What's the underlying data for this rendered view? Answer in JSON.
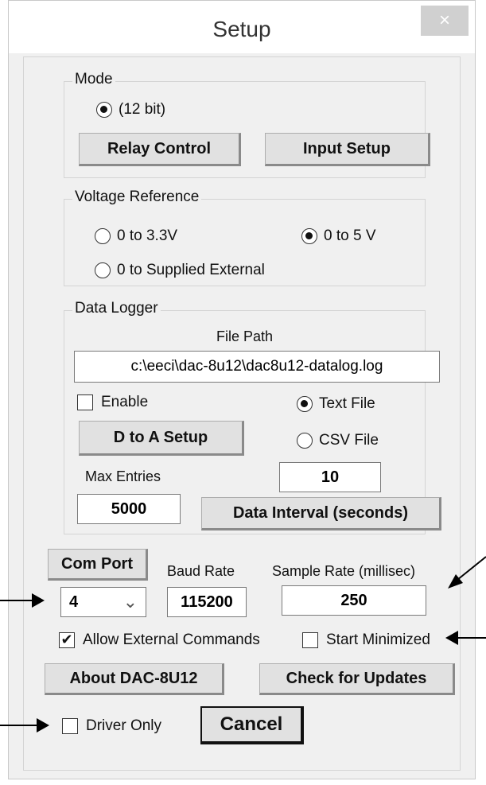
{
  "window": {
    "title": "Setup",
    "close_glyph": "×"
  },
  "mode": {
    "legend": "Mode",
    "radio_label": "(12 bit)",
    "relay_button": "Relay Control",
    "input_button": "Input Setup"
  },
  "voltage": {
    "legend": "Voltage Reference",
    "options": [
      "0 to 3.3V",
      "0 to 5 V",
      "0 to Supplied External"
    ],
    "selected": "0 to 5 V"
  },
  "logger": {
    "legend": "Data Logger",
    "file_path_label": "File Path",
    "file_path_value": "c:\\eeci\\dac-8u12\\dac8u12-datalog.log",
    "enable_label": "Enable",
    "text_file_label": "Text File",
    "csv_file_label": "CSV File",
    "d_to_a_button": "D to A Setup",
    "max_entries_label": "Max Entries",
    "max_entries_value": "5000",
    "interval_value": "10",
    "interval_button": "Data Interval (seconds)"
  },
  "com": {
    "com_port_button": "Com Port",
    "com_port_value": "4",
    "baud_label": "Baud Rate",
    "baud_value": "115200",
    "sample_label": "Sample Rate (millisec)",
    "sample_value": "250"
  },
  "options": {
    "allow_external_label": "Allow External Commands",
    "start_minimized_label": "Start Minimized",
    "driver_only_label": "Driver Only"
  },
  "buttons": {
    "about": "About DAC-8U12",
    "updates": "Check for Updates",
    "cancel": "Cancel"
  },
  "icons": {
    "check_glyph": "✔",
    "dropdown_glyph": "⌄"
  }
}
